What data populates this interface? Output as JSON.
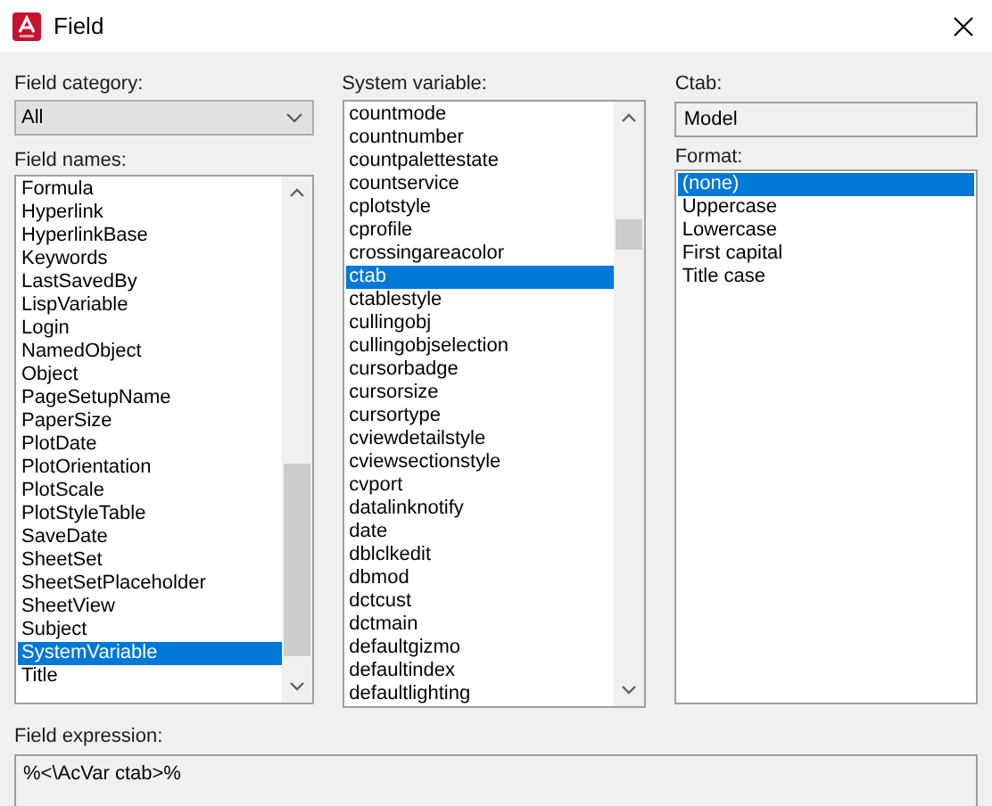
{
  "window": {
    "title": "Field"
  },
  "field_category": {
    "label": "Field category:",
    "value": "All"
  },
  "field_names": {
    "label": "Field names:",
    "items": [
      {
        "label": "Formula",
        "selected": false
      },
      {
        "label": "Hyperlink",
        "selected": false
      },
      {
        "label": "HyperlinkBase",
        "selected": false
      },
      {
        "label": "Keywords",
        "selected": false
      },
      {
        "label": "LastSavedBy",
        "selected": false
      },
      {
        "label": "LispVariable",
        "selected": false
      },
      {
        "label": "Login",
        "selected": false
      },
      {
        "label": "NamedObject",
        "selected": false
      },
      {
        "label": "Object",
        "selected": false
      },
      {
        "label": "PageSetupName",
        "selected": false
      },
      {
        "label": "PaperSize",
        "selected": false
      },
      {
        "label": "PlotDate",
        "selected": false
      },
      {
        "label": "PlotOrientation",
        "selected": false
      },
      {
        "label": "PlotScale",
        "selected": false
      },
      {
        "label": "PlotStyleTable",
        "selected": false
      },
      {
        "label": "SaveDate",
        "selected": false
      },
      {
        "label": "SheetSet",
        "selected": false
      },
      {
        "label": "SheetSetPlaceholder",
        "selected": false
      },
      {
        "label": "SheetView",
        "selected": false
      },
      {
        "label": "Subject",
        "selected": false
      },
      {
        "label": "SystemVariable",
        "selected": true
      },
      {
        "label": "Title",
        "selected": false
      }
    ]
  },
  "system_variable": {
    "label": "System variable:",
    "items": [
      {
        "label": "countmode",
        "selected": false
      },
      {
        "label": "countnumber",
        "selected": false
      },
      {
        "label": "countpalettestate",
        "selected": false
      },
      {
        "label": "countservice",
        "selected": false
      },
      {
        "label": "cplotstyle",
        "selected": false
      },
      {
        "label": "cprofile",
        "selected": false
      },
      {
        "label": "crossingareacolor",
        "selected": false
      },
      {
        "label": "ctab",
        "selected": true
      },
      {
        "label": "ctablestyle",
        "selected": false
      },
      {
        "label": "cullingobj",
        "selected": false
      },
      {
        "label": "cullingobjselection",
        "selected": false
      },
      {
        "label": "cursorbadge",
        "selected": false
      },
      {
        "label": "cursorsize",
        "selected": false
      },
      {
        "label": "cursortype",
        "selected": false
      },
      {
        "label": "cviewdetailstyle",
        "selected": false
      },
      {
        "label": "cviewsectionstyle",
        "selected": false
      },
      {
        "label": "cvport",
        "selected": false
      },
      {
        "label": "datalinknotify",
        "selected": false
      },
      {
        "label": "date",
        "selected": false
      },
      {
        "label": "dblclkedit",
        "selected": false
      },
      {
        "label": "dbmod",
        "selected": false
      },
      {
        "label": "dctcust",
        "selected": false
      },
      {
        "label": "dctmain",
        "selected": false
      },
      {
        "label": "defaultgizmo",
        "selected": false
      },
      {
        "label": "defaultindex",
        "selected": false
      },
      {
        "label": "defaultlighting",
        "selected": false
      }
    ]
  },
  "ctab": {
    "label": "Ctab:",
    "value": "Model"
  },
  "format": {
    "label": "Format:",
    "items": [
      {
        "label": "(none)",
        "selected": true
      },
      {
        "label": "Uppercase",
        "selected": false
      },
      {
        "label": "Lowercase",
        "selected": false
      },
      {
        "label": "First capital",
        "selected": false
      },
      {
        "label": "Title case",
        "selected": false
      }
    ]
  },
  "field_expression": {
    "label": "Field expression:",
    "value": "%<\\AcVar ctab>%"
  }
}
